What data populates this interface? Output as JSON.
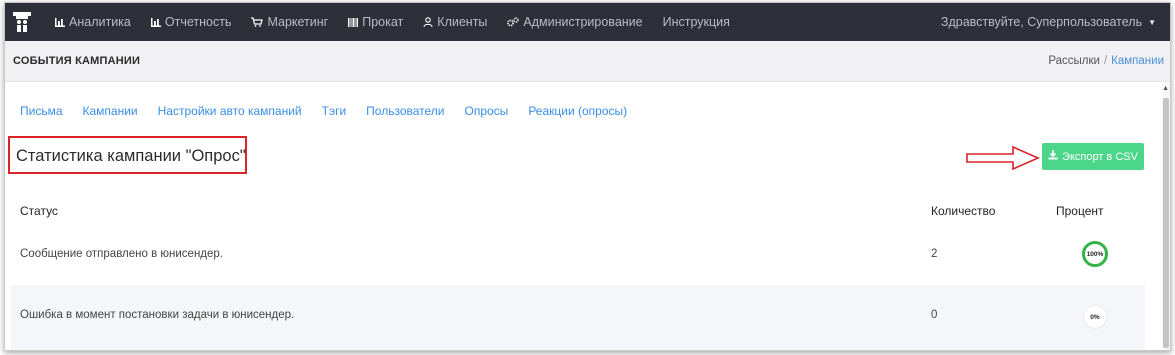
{
  "nav": {
    "items": [
      {
        "label": "Аналитика",
        "icon": "bar-chart-icon"
      },
      {
        "label": "Отчетность",
        "icon": "bar-chart-icon"
      },
      {
        "label": "Маркетинг",
        "icon": "cart-icon"
      },
      {
        "label": "Прокат",
        "icon": "barcode-icon"
      },
      {
        "label": "Клиенты",
        "icon": "user-icon"
      },
      {
        "label": "Администрирование",
        "icon": "gears-icon"
      },
      {
        "label": "Инструкция"
      }
    ],
    "user_greeting": "Здравствуйте, Суперпользователь"
  },
  "header": {
    "title": "СОБЫТИЯ КАМПАНИИ",
    "breadcrumb": [
      "Рассылки",
      "Кампании"
    ]
  },
  "tabs": [
    "Письма",
    "Кампании",
    "Настройки авто кампаний",
    "Тэги",
    "Пользователи",
    "Опросы",
    "Реакции (опросы)"
  ],
  "heading": "Статистика кампании \"Опрос\"",
  "export_label": "Экспорт в CSV",
  "table": {
    "headers": {
      "status": "Статус",
      "count": "Количество",
      "percent": "Процент"
    },
    "rows": [
      {
        "status": "Сообщение отправлено в юнисендер.",
        "count": "2",
        "percent": "100%"
      },
      {
        "status": "Ошибка в момент постановки задачи в юнисендер.",
        "count": "0",
        "percent": "0%"
      }
    ]
  },
  "colors": {
    "nav_bg": "#2d3039",
    "accent_link": "#3a8ee6",
    "export_bg": "#4cd68a",
    "highlight_red": "#d9252a",
    "progress_green": "#35b24a"
  }
}
